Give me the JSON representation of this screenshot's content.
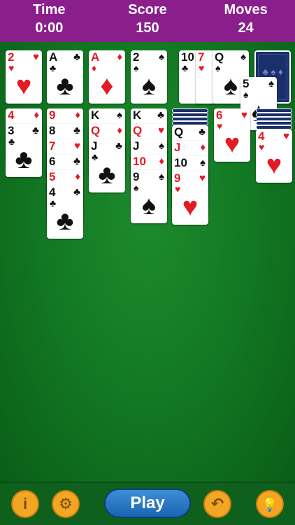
{
  "header": {
    "time_label": "Time",
    "time_value": "0:00",
    "score_label": "Score",
    "score_value": "150",
    "moves_label": "Moves",
    "moves_value": "24"
  },
  "foundations": [
    {
      "rank": "2",
      "suit": "♥",
      "color": "red"
    },
    {
      "rank": "A",
      "suit": "♣",
      "color": "black"
    },
    {
      "rank": "A",
      "suit": "♦",
      "color": "red"
    },
    {
      "rank": "2",
      "suit": "♠",
      "color": "black"
    }
  ],
  "waste": [
    {
      "rank": "10",
      "suit": "♣",
      "color": "black"
    },
    {
      "rank": "7",
      "suit": "♥",
      "color": "red"
    },
    {
      "rank": "Q",
      "suit": "♠",
      "color": "black"
    }
  ],
  "moving_card": {
    "rank": "5",
    "suit": "♠",
    "color": "black"
  },
  "stock_back_suits": [
    "♣",
    "♠",
    "♦",
    "♥"
  ],
  "tableau": [
    [
      {
        "rank": "4",
        "suit": "♦"
      },
      {
        "rank": "3",
        "suit": "♣"
      }
    ],
    [
      {
        "rank": "9",
        "suit": "♦"
      },
      {
        "rank": "8",
        "suit": "♣"
      },
      {
        "rank": "7",
        "suit": "♥"
      },
      {
        "rank": "6",
        "suit": "♣"
      },
      {
        "rank": "5",
        "suit": "♦"
      },
      {
        "rank": "4",
        "suit": "♣"
      }
    ],
    [
      {
        "rank": "K",
        "suit": "♠"
      },
      {
        "rank": "Q",
        "suit": "♦"
      },
      {
        "rank": "J",
        "suit": "♣"
      }
    ],
    [
      {
        "rank": "K",
        "suit": "♣"
      },
      {
        "rank": "Q",
        "suit": "♥"
      },
      {
        "rank": "J",
        "suit": "♠"
      },
      {
        "rank": "10",
        "suit": "♦"
      },
      {
        "rank": "9",
        "suit": "♠"
      }
    ],
    [
      {
        "rank": "Q",
        "suit": "♣"
      },
      {
        "rank": "J",
        "suit": "♦"
      },
      {
        "rank": "10",
        "suit": "♠"
      },
      {
        "rank": "9",
        "suit": "♥"
      }
    ],
    [
      {
        "rank": "6",
        "suit": "♥"
      }
    ],
    [
      {
        "rank": "4",
        "suit": "♥"
      }
    ]
  ],
  "toolbar": {
    "info_icon": "i",
    "settings_icon": "⚙",
    "play_label": "Play",
    "undo_icon": "↶",
    "hint_icon": "💡"
  },
  "colors": {
    "accent": "#8a1f8c",
    "felt": "#137a24",
    "card_red": "#e31b23",
    "button_orange": "#f2a623",
    "play_blue": "#1b64b3"
  }
}
